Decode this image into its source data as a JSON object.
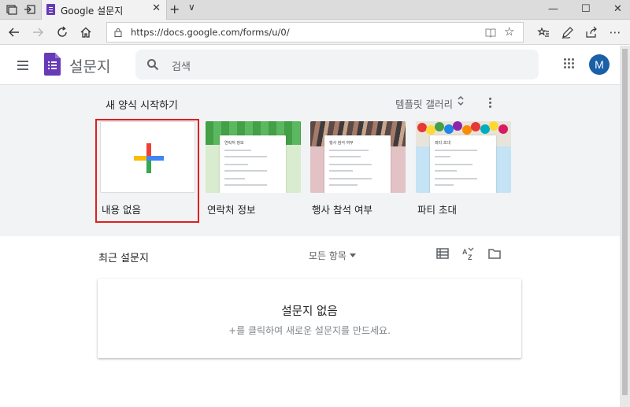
{
  "browser": {
    "tab_title": "Google 설문지",
    "tab_close": "✕",
    "new_tab": "+",
    "tab_list": "∨",
    "window_controls": {
      "minimize": "—",
      "maximize": "☐",
      "close": "✕"
    },
    "url": "https://docs.google.com/forms/u/0/",
    "more": "⋯"
  },
  "header": {
    "app_title": "설문지",
    "search_placeholder": "검색",
    "avatar_initial": "M"
  },
  "gallery": {
    "title": "새 양식 시작하기",
    "gallery_link": "템플릿 갤러리",
    "templates": [
      {
        "label": "내용 없음"
      },
      {
        "label": "연락처 정보",
        "sheet_title": "연락처 정보"
      },
      {
        "label": "행사 참석 여부",
        "sheet_title": "행사 참석 여부"
      },
      {
        "label": "파티 초대",
        "sheet_title": "파티 초대"
      }
    ]
  },
  "recent": {
    "title": "최근 설문지",
    "filter": "모든 항목",
    "empty_title": "설문지 없음",
    "empty_subtitle": "+를 클릭하여 새로운 설문지를 만드세요."
  },
  "colors": {
    "forms_purple": "#673ab7",
    "selection_red": "#e01f1f",
    "avatar_blue": "#1a5fa8",
    "plus_red": "#ea4335",
    "plus_blue": "#4285f4",
    "plus_green": "#34a853",
    "plus_yellow": "#fbbc04"
  }
}
